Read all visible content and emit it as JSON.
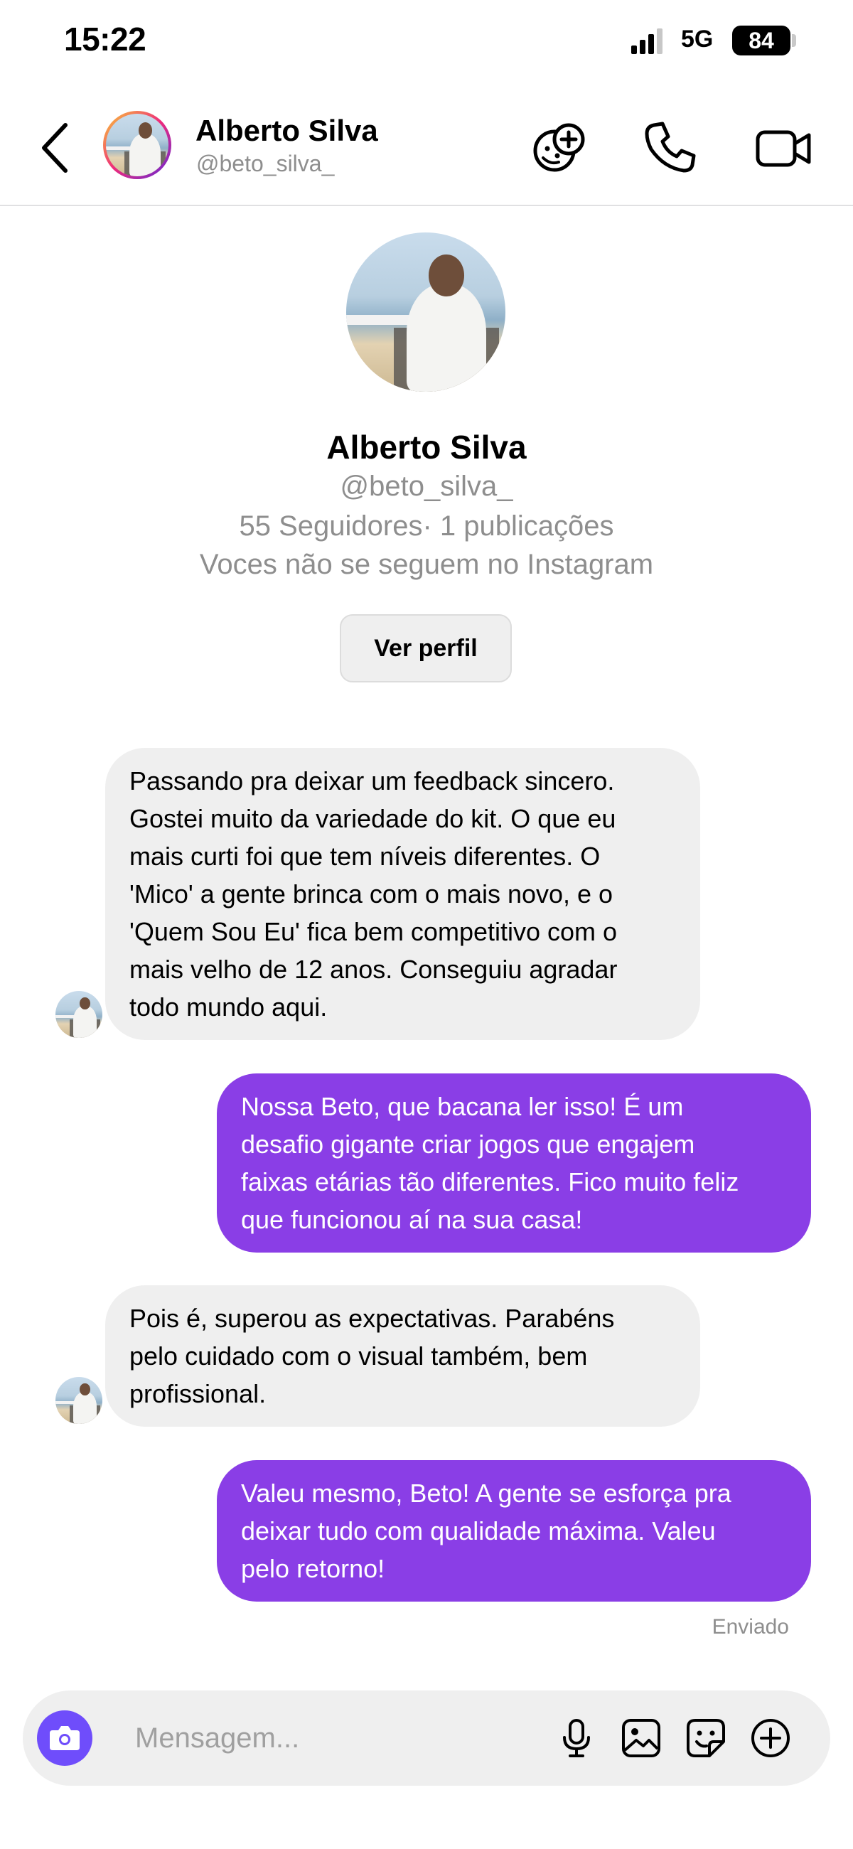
{
  "status_bar": {
    "time": "15:22",
    "network": "5G",
    "battery": "84"
  },
  "header": {
    "name": "Alberto Silva",
    "handle": "@beto_silva_"
  },
  "profile": {
    "name": "Alberto Silva",
    "handle": "@beto_silva_",
    "stats": "55 Seguidores· 1 publicações",
    "follow_status": "Voces não se seguem no Instagram",
    "view_profile_label": "Ver perfil"
  },
  "messages": [
    {
      "direction": "in",
      "lines": [
        "Passando pra deixar um feedback sincero.",
        "Gostei muito da variedade do kit. O que eu",
        "mais curti foi que tem níveis diferentes. O",
        "'Mico' a gente brinca com o mais novo, e o",
        "'Quem Sou Eu' fica bem competitivo com o",
        "mais velho de 12 anos. Conseguiu agradar",
        "todo mundo aqui."
      ]
    },
    {
      "direction": "out",
      "lines": [
        "Nossa Beto, que bacana ler isso! É um",
        "desafio gigante criar jogos que engajem",
        "faixas etárias tão diferentes. Fico muito feliz",
        "que funcionou aí na sua casa!"
      ]
    },
    {
      "direction": "in",
      "lines": [
        "Pois é, superou as expectativas. Parabéns",
        "pelo cuidado com o visual também, bem",
        "profissional."
      ]
    },
    {
      "direction": "out",
      "lines": [
        "Valeu mesmo, Beto! A gente se esforça pra",
        "deixar tudo com qualidade máxima. Valeu",
        "pelo retorno!"
      ]
    }
  ],
  "sent_status": "Enviado",
  "composer": {
    "placeholder": "Mensagem..."
  },
  "colors": {
    "outgoing_bubble": "#8a3ee6",
    "incoming_bubble": "#efefef",
    "camera_button": "#6f4dfb",
    "secondary_text": "#8e8e8e"
  },
  "icons": [
    "back-arrow-icon",
    "game-icon",
    "phone-icon",
    "video-camera-icon",
    "camera-icon",
    "microphone-icon",
    "gallery-icon",
    "sticker-icon",
    "plus-circle-icon"
  ]
}
